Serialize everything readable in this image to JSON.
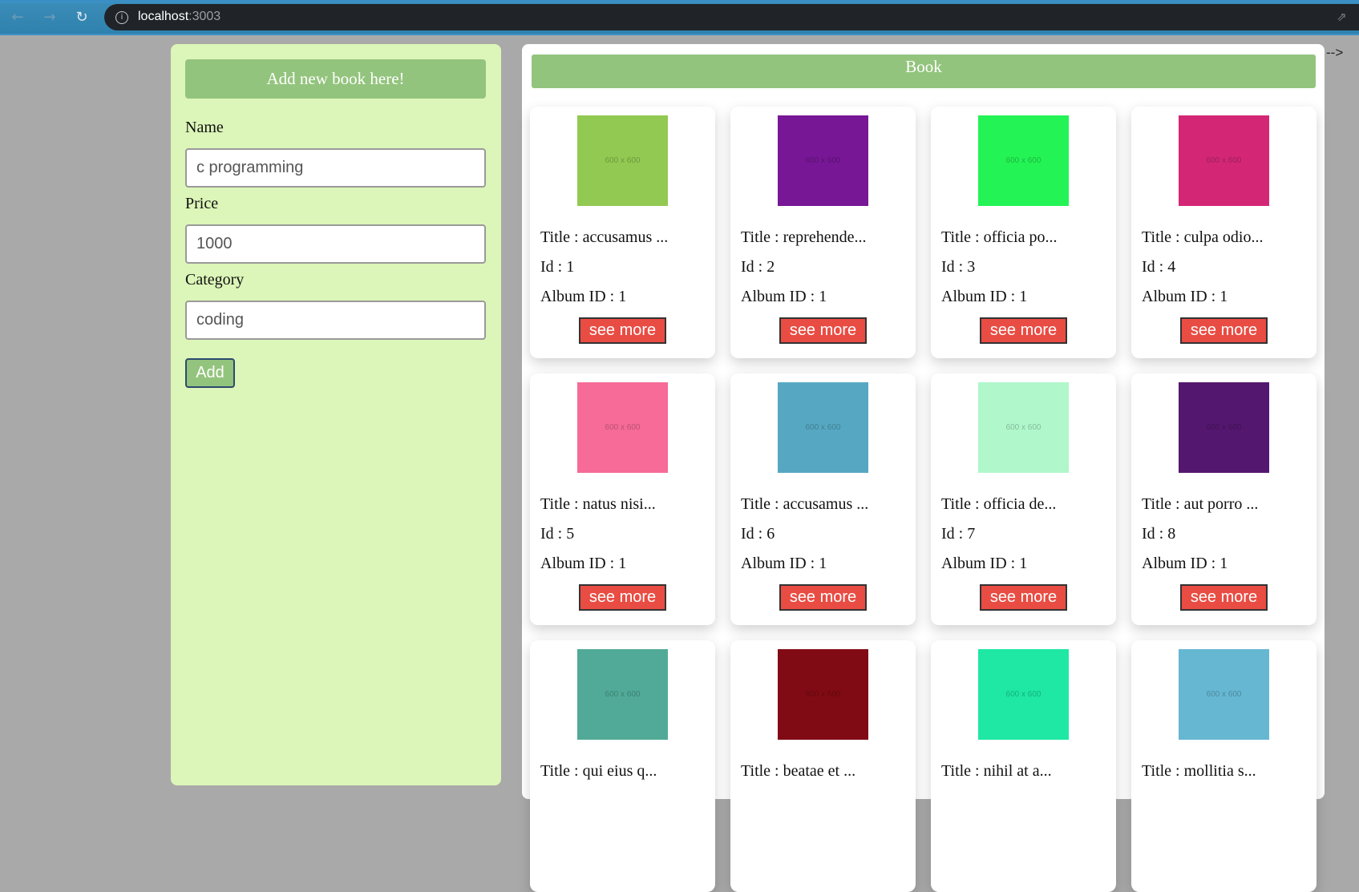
{
  "browser": {
    "url_host": "localhost",
    "url_port": ":3003",
    "back_icon": "←",
    "forward_icon": "→",
    "reload_icon": "↻",
    "info_icon": "i",
    "share_icon": "⇗"
  },
  "form": {
    "header": "Add new book here!",
    "name_label": "Name",
    "name_value": "c programming",
    "price_label": "Price",
    "price_value": "1000",
    "category_label": "Category",
    "category_value": "coding",
    "add_label": "Add"
  },
  "books": {
    "header": "Book",
    "stray_text": "-->",
    "see_more_label": "see more",
    "items": [
      {
        "title": "Title : accusamus ...",
        "id": "Id : 1",
        "album": "Album ID : 1",
        "color": "#92c952",
        "thumb_text": "600 x 600"
      },
      {
        "title": "Title : reprehende...",
        "id": "Id : 2",
        "album": "Album ID : 1",
        "color": "#771796",
        "thumb_text": "600 x 600"
      },
      {
        "title": "Title : officia po...",
        "id": "Id : 3",
        "album": "Album ID : 1",
        "color": "#24f355",
        "thumb_text": "600 x 600"
      },
      {
        "title": "Title : culpa odio...",
        "id": "Id : 4",
        "album": "Album ID : 1",
        "color": "#d32776",
        "thumb_text": "600 x 600"
      },
      {
        "title": "Title : natus nisi...",
        "id": "Id : 5",
        "album": "Album ID : 1",
        "color": "#f66b97",
        "thumb_text": "600 x 600"
      },
      {
        "title": "Title : accusamus ...",
        "id": "Id : 6",
        "album": "Album ID : 1",
        "color": "#56a8c2",
        "thumb_text": "600 x 600"
      },
      {
        "title": "Title : officia de...",
        "id": "Id : 7",
        "album": "Album ID : 1",
        "color": "#b0f7cc",
        "thumb_text": "600 x 600"
      },
      {
        "title": "Title : aut porro ...",
        "id": "Id : 8",
        "album": "Album ID : 1",
        "color": "#54176f",
        "thumb_text": "600 x 600"
      },
      {
        "title": "Title : qui eius q...",
        "id": "",
        "album": "",
        "color": "#51aa97",
        "thumb_text": "600 x 600"
      },
      {
        "title": "Title : beatae et ...",
        "id": "",
        "album": "",
        "color": "#810b14",
        "thumb_text": "600 x 600"
      },
      {
        "title": "Title : nihil at a...",
        "id": "",
        "album": "",
        "color": "#1ee8a4",
        "thumb_text": "600 x 600"
      },
      {
        "title": "Title : mollitia s...",
        "id": "",
        "album": "",
        "color": "#66b7d2",
        "thumb_text": "600 x 600"
      }
    ]
  }
}
